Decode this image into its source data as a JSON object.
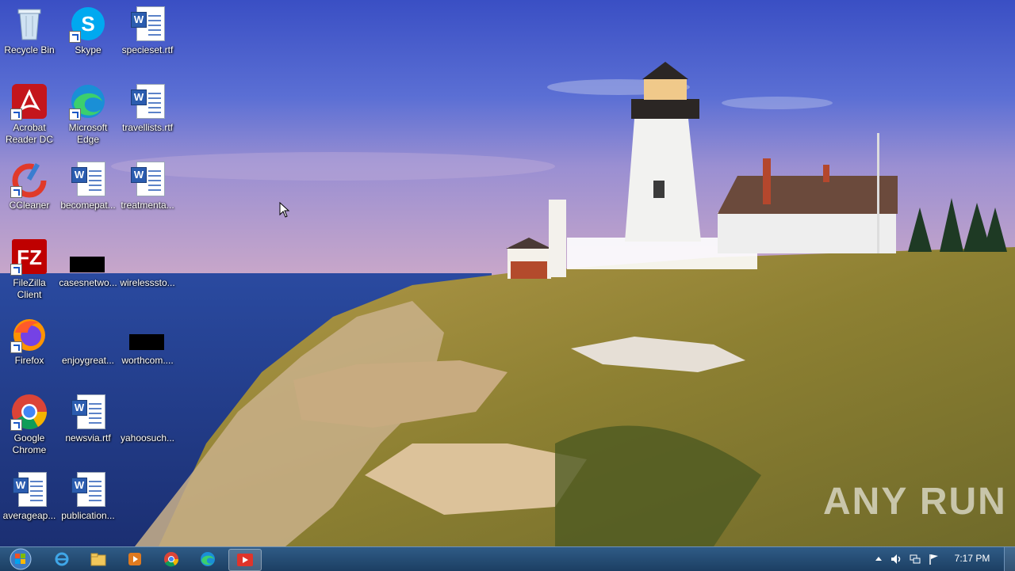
{
  "desktop": {
    "icons": [
      {
        "label": "Recycle Bin",
        "icon": "recycle-bin-icon"
      },
      {
        "label": "Skype",
        "icon": "skype-icon"
      },
      {
        "label": "specieset.rtf",
        "icon": "word-document-icon"
      },
      {
        "label": "Acrobat Reader DC",
        "icon": "acrobat-reader-icon"
      },
      {
        "label": "Microsoft Edge",
        "icon": "edge-icon"
      },
      {
        "label": "travellists.rtf",
        "icon": "word-document-icon"
      },
      {
        "label": "CCleaner",
        "icon": "ccleaner-icon"
      },
      {
        "label": "becomepat...",
        "icon": "word-document-icon"
      },
      {
        "label": "treatmenta...",
        "icon": "word-document-icon"
      },
      {
        "label": "FileZilla Client",
        "icon": "filezilla-icon"
      },
      {
        "label": "casesnetwo...",
        "icon": "blank-file-icon"
      },
      {
        "label": "wirelesssto...",
        "icon": "blank-file-icon"
      },
      {
        "label": "Firefox",
        "icon": "firefox-icon"
      },
      {
        "label": "enjoygreat...",
        "icon": "blank-file-icon"
      },
      {
        "label": "worthcom....",
        "icon": "blank-file-icon"
      },
      {
        "label": "Google Chrome",
        "icon": "chrome-icon"
      },
      {
        "label": "newsvia.rtf",
        "icon": "word-document-icon"
      },
      {
        "label": "yahoosuch...",
        "icon": "blank-file-icon"
      },
      {
        "label": "averageap...",
        "icon": "word-document-icon"
      },
      {
        "label": "publication...",
        "icon": "word-document-icon"
      }
    ]
  },
  "taskbar": {
    "start_icon": "windows-start-icon",
    "pinned": [
      {
        "name": "internet-explorer-icon"
      },
      {
        "name": "file-explorer-icon"
      },
      {
        "name": "media-player-icon"
      },
      {
        "name": "chrome-icon"
      },
      {
        "name": "edge-icon"
      },
      {
        "name": "anyrun-app-icon"
      }
    ],
    "tray": {
      "icons": [
        "show-hidden-icons-chevron",
        "volume-icon",
        "network-icon",
        "action-center-flag-icon"
      ],
      "clock": "7:17 PM"
    }
  },
  "watermark": "ANY RUN",
  "colors": {
    "taskbar": "#1c3f63",
    "sky_top": "#3a55c8",
    "sea": "#23408f",
    "grass": "#8a7a2c",
    "lighthouse": "#f2f2f0"
  }
}
